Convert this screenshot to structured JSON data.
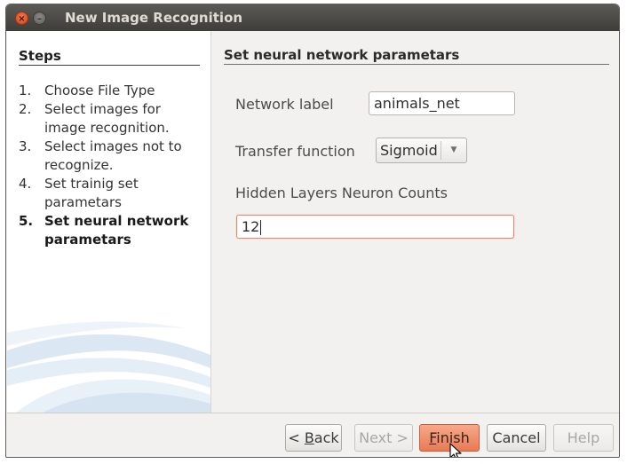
{
  "window": {
    "title": "New Image Recognition"
  },
  "steps": {
    "title": "Steps",
    "items": [
      {
        "num": "1.",
        "label": "Choose File Type"
      },
      {
        "num": "2.",
        "label": "Select images for image recognition."
      },
      {
        "num": "3.",
        "label": "Select images not to recognize."
      },
      {
        "num": "4.",
        "label": "Set trainig set parametars"
      },
      {
        "num": "5.",
        "label": "Set neural network parametars"
      }
    ],
    "active_step": 5
  },
  "content": {
    "title": "Set neural network parametars",
    "network_label": {
      "label": "Network label",
      "value": "animals_net"
    },
    "transfer_function": {
      "label": "Transfer function",
      "value": "Sigmoid"
    },
    "hidden_layers": {
      "label": "Hidden Layers Neuron Counts",
      "value": "12"
    }
  },
  "buttons": {
    "back": {
      "prefix": "< ",
      "mnemonic": "B",
      "rest": "ack",
      "enabled": true
    },
    "next": {
      "label": "Next >",
      "enabled": false
    },
    "finish": {
      "mnemonic": "F",
      "rest": "inish",
      "enabled": true
    },
    "cancel": {
      "label": "Cancel",
      "enabled": true
    },
    "help": {
      "label": "Help",
      "enabled": false
    }
  },
  "colors": {
    "accent": "#e97a54",
    "focus_border": "#e88764",
    "titlebar": "#3e3d39"
  }
}
